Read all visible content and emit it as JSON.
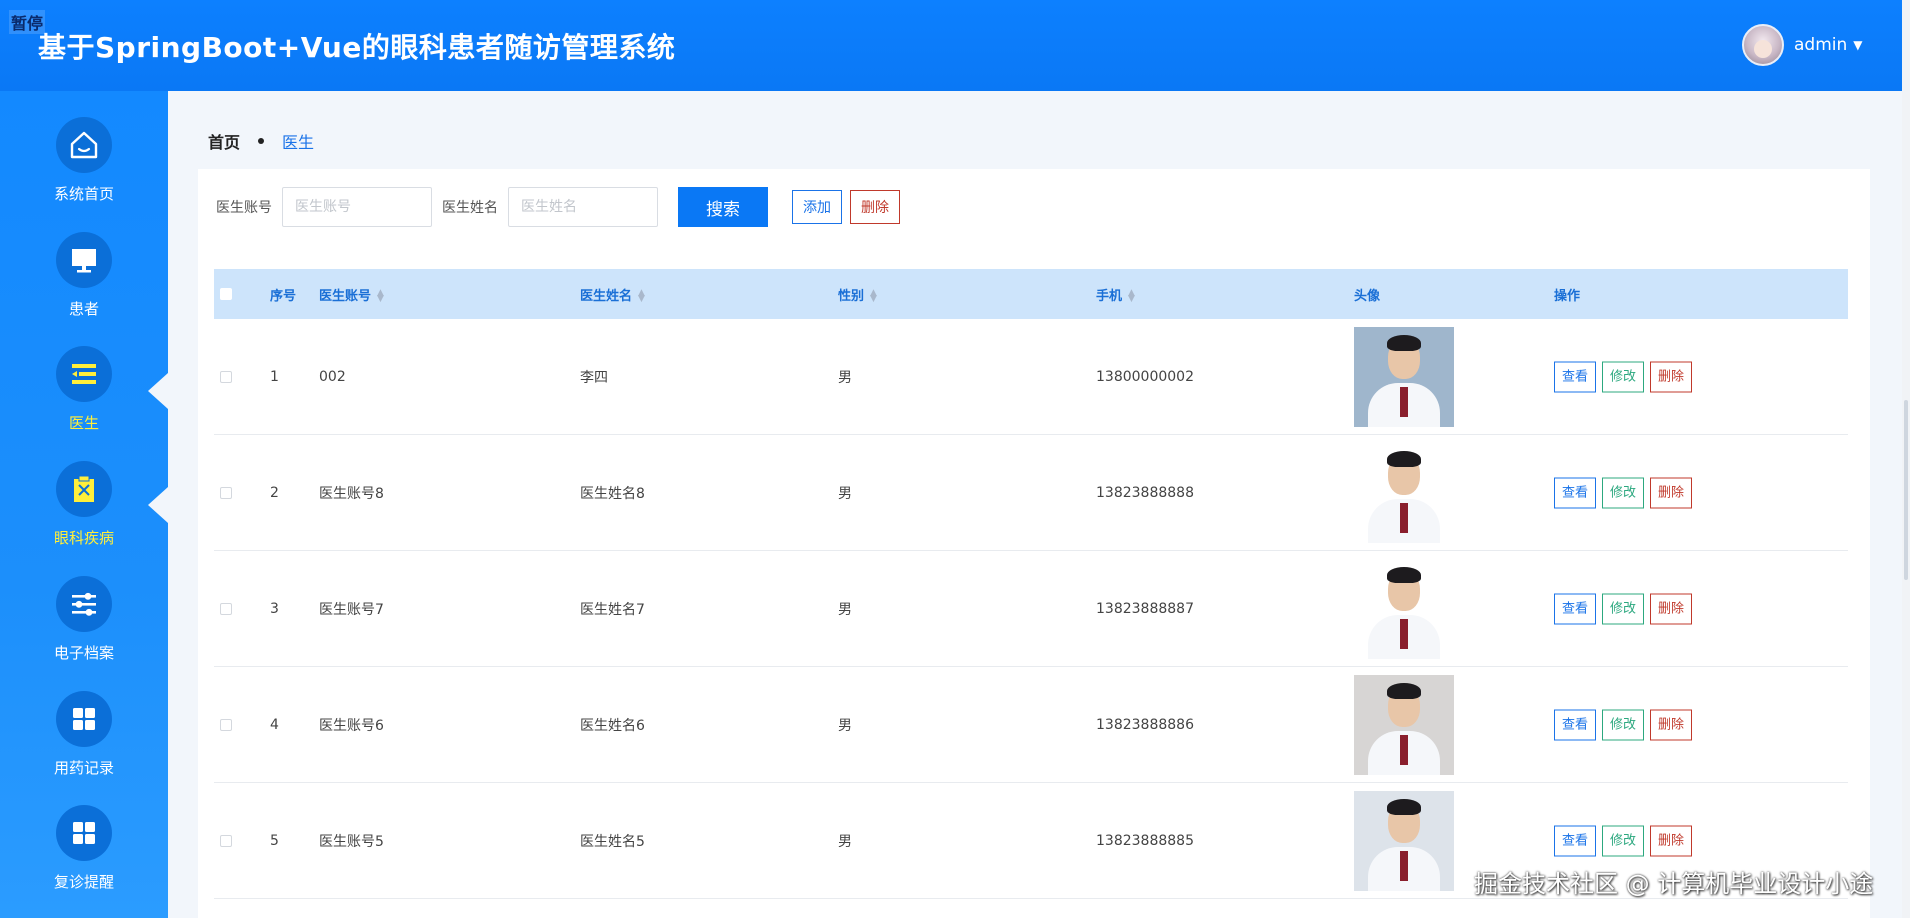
{
  "header": {
    "pause_tag": "暂停",
    "title": "基于SpringBoot+Vue的眼科患者随访管理系统",
    "user_name": "admin",
    "caret": "▼"
  },
  "sidebar": {
    "items": [
      {
        "label": "系统首页",
        "icon": "home-icon",
        "active": false
      },
      {
        "label": "患者",
        "icon": "monitor-icon",
        "active": false
      },
      {
        "label": "医生",
        "icon": "list-icon",
        "active": true
      },
      {
        "label": "眼科疾病",
        "icon": "clipboard-icon",
        "active": true
      },
      {
        "label": "电子档案",
        "icon": "sliders-icon",
        "active": false
      },
      {
        "label": "用药记录",
        "icon": "grid-icon",
        "active": false
      },
      {
        "label": "复诊提醒",
        "icon": "grid-icon",
        "active": false
      }
    ]
  },
  "breadcrumb": {
    "home": "首页",
    "current": "医生"
  },
  "search": {
    "account_label": "医生账号",
    "account_placeholder": "医生账号",
    "name_label": "医生姓名",
    "name_placeholder": "医生姓名",
    "search_button": "搜索",
    "add_button": "添加",
    "delete_button": "删除"
  },
  "table": {
    "headers": {
      "index": "序号",
      "account": "医生账号",
      "name": "医生姓名",
      "gender": "性别",
      "phone": "手机",
      "avatar": "头像",
      "actions": "操作"
    },
    "action_labels": {
      "view": "查看",
      "edit": "修改",
      "delete": "删除"
    },
    "rows": [
      {
        "index": "1",
        "account": "002",
        "name": "李四",
        "gender": "男",
        "phone": "13800000002",
        "photo_bg": "#9fb6cc"
      },
      {
        "index": "2",
        "account": "医生账号8",
        "name": "医生姓名8",
        "gender": "男",
        "phone": "13823888888",
        "photo_bg": "#ffffff"
      },
      {
        "index": "3",
        "account": "医生账号7",
        "name": "医生姓名7",
        "gender": "男",
        "phone": "13823888887",
        "photo_bg": "#ffffff"
      },
      {
        "index": "4",
        "account": "医生账号6",
        "name": "医生姓名6",
        "gender": "男",
        "phone": "13823888886",
        "photo_bg": "#d7d5d4"
      },
      {
        "index": "5",
        "account": "医生账号5",
        "name": "医生姓名5",
        "gender": "男",
        "phone": "13823888885",
        "photo_bg": "#dde3ea"
      }
    ]
  },
  "watermark": "掘金技术社区 @ 计算机毕业设计小途",
  "colors": {
    "primary": "#0a78f5",
    "active_nav": "#ffef3a",
    "header_row": "#cde4fb",
    "delete": "#c0392b",
    "edit": "#2ca87f"
  }
}
